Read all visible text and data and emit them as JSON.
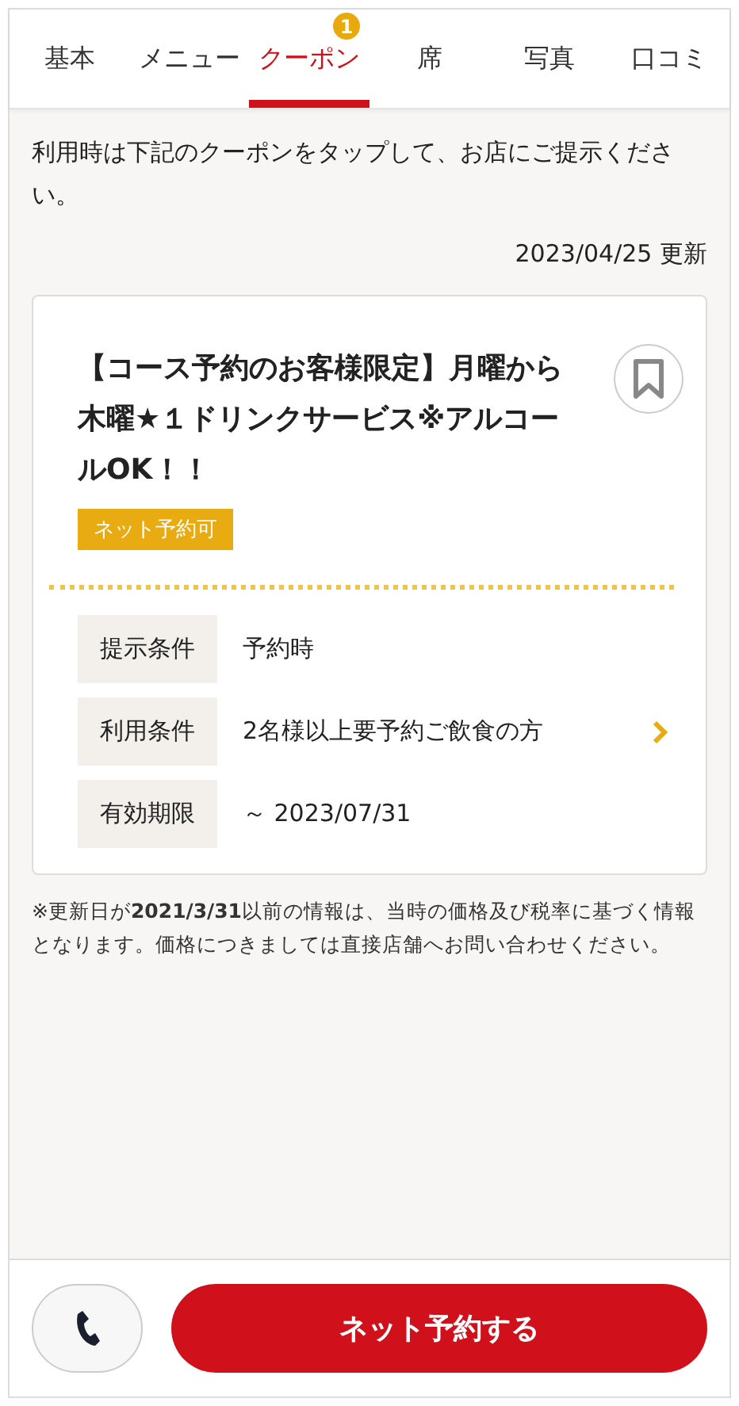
{
  "tabs": [
    {
      "label": "基本",
      "selected": false
    },
    {
      "label": "メニュー",
      "selected": false
    },
    {
      "label": "クーポン",
      "selected": true,
      "badge": "1"
    },
    {
      "label": "席",
      "selected": false
    },
    {
      "label": "写真",
      "selected": false
    },
    {
      "label": "口コミ",
      "selected": false
    }
  ],
  "intro": "利用時は下記のクーポンをタップして、お店にご提示ください。",
  "updated": "2023/04/25 更新",
  "coupon": {
    "title": "【コース予約のお客様限定】月曜から木曜★１ドリンクサービス※アルコールOK！！",
    "tag": "ネット予約可",
    "bookmarked": false,
    "conditions": [
      {
        "label": "提示条件",
        "value": "予約時",
        "has_link": false
      },
      {
        "label": "利用条件",
        "value": "2名様以上要予約ご飲食の方",
        "has_link": true
      },
      {
        "label": "有効期限",
        "value": "～ 2023/07/31",
        "has_link": false
      }
    ]
  },
  "note": "※更新日が**2021/3/31**以前の情報は、当時の価格及び税率に基づく情報となります。価格につきましては直接店舗へお問い合わせください。",
  "reserve_button": "ネット予約する"
}
